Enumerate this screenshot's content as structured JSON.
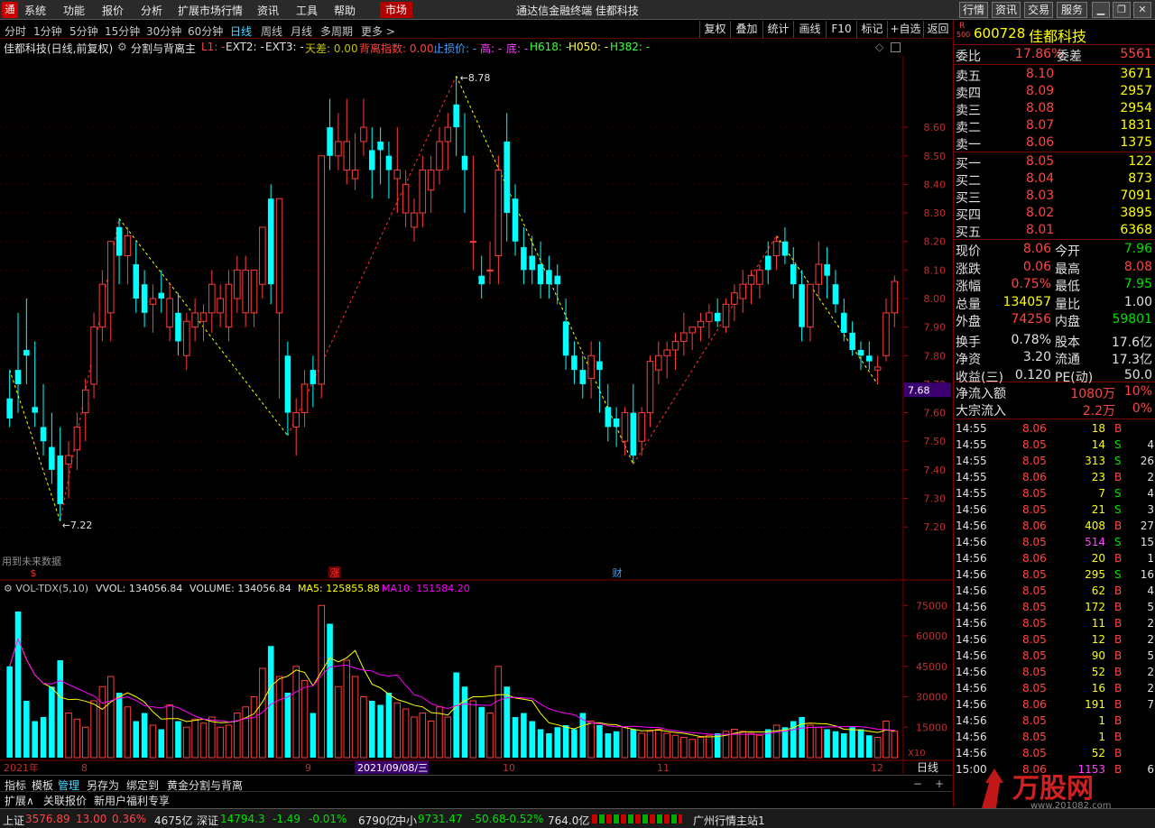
{
  "menu": {
    "items": [
      "系统",
      "功能",
      "报价",
      "分析",
      "扩展市场行情",
      "资讯",
      "工具",
      "帮助"
    ],
    "market": "市场",
    "title": "通达信金融终端  佳都科技",
    "right_buttons": [
      "行情",
      "资讯",
      "交易",
      "服务"
    ]
  },
  "timeframes": [
    "分时",
    "1分钟",
    "5分钟",
    "15分钟",
    "30分钟",
    "60分钟",
    "日线",
    "周线",
    "月线",
    "多周期",
    "更多 >"
  ],
  "active_timeframe": "日线",
  "tools": [
    "复权",
    "叠加",
    "统计",
    "画线",
    "F10",
    "标记",
    "+自选",
    "返回"
  ],
  "info": {
    "stock": "佳都科技(日线,前复权)",
    "indicator": "分割与背离主",
    "l1": "L1: -",
    "ext2": "EXT2: -",
    "ext3": "EXT3: -",
    "tiancha": "天差: 0.00",
    "beili": "背离指数: 0.00",
    "zhisun": "止损价: -",
    "gao": "高: -",
    "di": "底: -",
    "h618": "H618: -",
    "h050": "H050: -",
    "h382": "H382: -"
  },
  "chart_data": {
    "type": "candlestick",
    "ylim": [
      7.15,
      8.85
    ],
    "price_ticks": [
      "8.60",
      "8.50",
      "8.40",
      "8.30",
      "8.20",
      "8.10",
      "8.00",
      "7.90",
      "7.80",
      "7.70",
      "7.60",
      "7.50",
      "7.40",
      "7.30",
      "7.20"
    ],
    "price_label_current": "7.68",
    "high_label": "8.78",
    "low_label": "7.22",
    "future_data_text": "用到未来数据",
    "event_markers": [
      "$",
      "涨",
      "财"
    ],
    "vol_title": "VOL-TDX(5,10)",
    "vvol": "VVOL: 134056.84",
    "volume": "VOLUME: 134056.84",
    "ma5": "MA5: 125855.88",
    "ma10": "MA10: 151584.20",
    "vol_ticks": [
      "75000",
      "60000",
      "45000",
      "30000",
      "15000"
    ],
    "vol_unit": "X10",
    "x_labels": [
      "2021年",
      "8",
      "9",
      "2021/09/08/三",
      "10",
      "11",
      "12"
    ],
    "panel_label": "日线",
    "candles": [
      [
        7.65,
        7.75,
        7.55,
        7.58
      ],
      [
        7.75,
        7.95,
        7.6,
        7.7
      ],
      [
        7.82,
        8.0,
        7.7,
        7.8
      ],
      [
        7.62,
        7.85,
        7.55,
        7.6
      ],
      [
        7.55,
        7.7,
        7.45,
        7.5
      ],
      [
        7.48,
        7.6,
        7.35,
        7.4
      ],
      [
        7.45,
        7.55,
        7.22,
        7.28
      ],
      [
        7.42,
        7.5,
        7.3,
        7.45
      ],
      [
        7.47,
        7.6,
        7.4,
        7.55
      ],
      [
        7.6,
        7.72,
        7.5,
        7.68
      ],
      [
        7.7,
        7.95,
        7.65,
        7.9
      ],
      [
        7.9,
        8.1,
        7.85,
        8.05
      ],
      [
        7.95,
        8.15,
        7.85,
        8.2
      ],
      [
        8.25,
        8.28,
        8.05,
        8.15
      ],
      [
        8.15,
        8.25,
        8.05,
        8.22
      ],
      [
        8.12,
        8.2,
        7.95,
        8.0
      ],
      [
        8.05,
        8.1,
        7.9,
        7.95
      ],
      [
        7.98,
        8.05,
        7.88,
        8.0
      ],
      [
        8.02,
        8.1,
        7.95,
        8.0
      ],
      [
        7.9,
        8.05,
        7.85,
        8.0
      ],
      [
        7.95,
        8.02,
        7.8,
        7.85
      ],
      [
        7.8,
        7.95,
        7.75,
        7.92
      ],
      [
        7.9,
        8.0,
        7.85,
        7.95
      ],
      [
        7.92,
        7.98,
        7.85,
        7.95
      ],
      [
        7.95,
        8.1,
        7.88,
        8.05
      ],
      [
        7.95,
        8.05,
        7.9,
        8.0
      ],
      [
        7.9,
        8.1,
        7.85,
        8.05
      ],
      [
        8.0,
        8.15,
        7.95,
        8.1
      ],
      [
        7.95,
        8.15,
        7.9,
        8.1
      ],
      [
        7.95,
        8.1,
        7.9,
        8.1
      ],
      [
        8.05,
        8.25,
        8.0,
        8.25
      ],
      [
        8.35,
        8.4,
        7.98,
        8.05
      ],
      [
        7.95,
        8.35,
        7.65,
        8.35
      ],
      [
        7.8,
        7.85,
        7.52,
        7.6
      ],
      [
        7.55,
        7.65,
        7.45,
        7.6
      ],
      [
        7.6,
        7.75,
        7.55,
        7.7
      ],
      [
        7.75,
        7.8,
        7.62,
        7.7
      ],
      [
        7.7,
        8.5,
        7.65,
        8.5
      ],
      [
        8.6,
        8.7,
        8.45,
        8.5
      ],
      [
        8.5,
        8.65,
        8.45,
        8.55
      ],
      [
        8.45,
        8.7,
        8.4,
        8.55
      ],
      [
        8.42,
        8.58,
        8.38,
        8.45
      ],
      [
        8.55,
        8.7,
        8.5,
        8.6
      ],
      [
        8.52,
        8.6,
        8.35,
        8.45
      ],
      [
        8.55,
        8.6,
        8.4,
        8.52
      ],
      [
        8.5,
        8.55,
        8.35,
        8.45
      ],
      [
        8.42,
        8.6,
        8.3,
        8.45
      ],
      [
        8.3,
        8.45,
        8.25,
        8.4
      ],
      [
        8.25,
        8.35,
        8.2,
        8.3
      ],
      [
        8.3,
        8.5,
        8.25,
        8.45
      ],
      [
        8.38,
        8.5,
        8.3,
        8.45
      ],
      [
        8.45,
        8.6,
        8.4,
        8.55
      ],
      [
        8.55,
        8.65,
        8.45,
        8.6
      ],
      [
        8.68,
        8.78,
        8.5,
        8.6
      ],
      [
        8.5,
        8.65,
        8.3,
        8.45
      ],
      [
        8.2,
        8.5,
        8.1,
        8.2
      ],
      [
        8.08,
        8.15,
        8.0,
        8.05
      ],
      [
        8.1,
        8.2,
        8.05,
        8.1
      ],
      [
        8.15,
        8.5,
        8.05,
        8.45
      ],
      [
        8.55,
        8.65,
        8.2,
        8.3
      ],
      [
        8.35,
        8.4,
        8.15,
        8.2
      ],
      [
        8.18,
        8.25,
        8.05,
        8.1
      ],
      [
        8.15,
        8.22,
        8.05,
        8.1
      ],
      [
        8.12,
        8.2,
        8.0,
        8.05
      ],
      [
        8.1,
        8.15,
        8.0,
        8.05
      ],
      [
        8.08,
        8.12,
        7.98,
        8.05
      ],
      [
        7.92,
        8.0,
        7.75,
        7.8
      ],
      [
        7.8,
        7.85,
        7.7,
        7.75
      ],
      [
        7.75,
        7.8,
        7.65,
        7.7
      ],
      [
        7.72,
        7.85,
        7.65,
        7.8
      ],
      [
        7.78,
        7.85,
        7.6,
        7.75
      ],
      [
        7.62,
        7.7,
        7.5,
        7.55
      ],
      [
        7.58,
        7.62,
        7.48,
        7.55
      ],
      [
        7.5,
        7.62,
        7.45,
        7.6
      ],
      [
        7.6,
        7.7,
        7.42,
        7.45
      ],
      [
        7.5,
        7.62,
        7.45,
        7.6
      ],
      [
        7.6,
        7.8,
        7.55,
        7.78
      ],
      [
        7.75,
        7.85,
        7.7,
        7.8
      ],
      [
        7.8,
        7.85,
        7.72,
        7.82
      ],
      [
        7.82,
        7.88,
        7.75,
        7.85
      ],
      [
        7.85,
        7.95,
        7.8,
        7.88
      ],
      [
        7.88,
        7.9,
        7.82,
        7.9
      ],
      [
        7.9,
        7.95,
        7.85,
        7.92
      ],
      [
        7.92,
        7.98,
        7.86,
        7.95
      ],
      [
        7.95,
        8.0,
        7.9,
        7.92
      ],
      [
        7.9,
        8.0,
        7.88,
        7.98
      ],
      [
        7.98,
        8.05,
        7.92,
        8.02
      ],
      [
        8.0,
        8.1,
        7.95,
        8.05
      ],
      [
        8.05,
        8.1,
        7.98,
        8.08
      ],
      [
        8.05,
        8.12,
        8.0,
        8.1
      ],
      [
        8.15,
        8.2,
        8.05,
        8.1
      ],
      [
        8.15,
        8.22,
        8.1,
        8.2
      ],
      [
        8.2,
        8.25,
        8.12,
        8.15
      ],
      [
        8.12,
        8.18,
        8.0,
        8.05
      ],
      [
        8.05,
        8.1,
        7.85,
        7.9
      ],
      [
        7.9,
        8.05,
        7.85,
        8.05
      ],
      [
        8.05,
        8.2,
        8.0,
        8.12
      ],
      [
        8.12,
        8.18,
        8.0,
        8.08
      ],
      [
        8.05,
        8.1,
        7.95,
        7.98
      ],
      [
        7.95,
        8.0,
        7.85,
        7.88
      ],
      [
        7.88,
        7.92,
        7.8,
        7.82
      ],
      [
        7.82,
        7.85,
        7.75,
        7.8
      ],
      [
        7.8,
        7.85,
        7.75,
        7.78
      ],
      [
        7.75,
        7.8,
        7.7,
        7.76
      ],
      [
        7.8,
        8.0,
        7.78,
        7.95
      ],
      [
        7.95,
        8.08,
        7.9,
        8.06
      ]
    ],
    "volumes": [
      45000,
      72000,
      28000,
      18000,
      20000,
      35000,
      48000,
      22000,
      19000,
      15000,
      28000,
      35000,
      40000,
      32000,
      25000,
      18000,
      22000,
      16000,
      14000,
      26000,
      18000,
      15000,
      19000,
      17000,
      20000,
      15000,
      16000,
      22000,
      25000,
      30000,
      44000,
      55000,
      40000,
      32000,
      45000,
      38000,
      22000,
      75000,
      66000,
      35000,
      48000,
      40000,
      30000,
      28000,
      26000,
      32000,
      27000,
      24000,
      20000,
      22000,
      18000,
      25000,
      20000,
      42000,
      35000,
      28000,
      25000,
      22000,
      45000,
      35000,
      20000,
      22000,
      18000,
      14000,
      12000,
      15000,
      16000,
      14000,
      22000,
      18000,
      16000,
      12000,
      13000,
      15000,
      14000,
      12000,
      13000,
      14000,
      12000,
      11000,
      10000,
      9000,
      10000,
      11000,
      12000,
      13000,
      14000,
      13000,
      12000,
      11000,
      14000,
      16000,
      15000,
      18000,
      20000,
      16000,
      15000,
      14000,
      13000,
      12000,
      15000,
      14000,
      11000,
      10000,
      18000,
      13000
    ]
  },
  "quote": {
    "code": "600728",
    "name": "佳都科技",
    "r_label": "R",
    "r_sub": "500",
    "webi_label": "委比",
    "webi": "17.86%",
    "weicha_label": "委差",
    "weicha": "5561",
    "asks": [
      {
        "label": "卖五",
        "price": "8.10",
        "vol": "3671"
      },
      {
        "label": "卖四",
        "price": "8.09",
        "vol": "2957"
      },
      {
        "label": "卖三",
        "price": "8.08",
        "vol": "2954"
      },
      {
        "label": "卖二",
        "price": "8.07",
        "vol": "1831"
      },
      {
        "label": "卖一",
        "price": "8.06",
        "vol": "1375"
      }
    ],
    "bids": [
      {
        "label": "买一",
        "price": "8.05",
        "vol": "122"
      },
      {
        "label": "买二",
        "price": "8.04",
        "vol": "873"
      },
      {
        "label": "买三",
        "price": "8.03",
        "vol": "7091"
      },
      {
        "label": "买四",
        "price": "8.02",
        "vol": "3895"
      },
      {
        "label": "买五",
        "price": "8.01",
        "vol": "6368"
      }
    ],
    "stats": [
      [
        {
          "l": "现价",
          "v": "8.06",
          "c": "#ff4444"
        },
        {
          "l": "今开",
          "v": "7.96",
          "c": "#00e000"
        }
      ],
      [
        {
          "l": "涨跌",
          "v": "0.06",
          "c": "#ff4444"
        },
        {
          "l": "最高",
          "v": "8.08",
          "c": "#ff4444"
        }
      ],
      [
        {
          "l": "涨幅",
          "v": "0.75%",
          "c": "#ff4444"
        },
        {
          "l": "最低",
          "v": "7.95",
          "c": "#00e000"
        }
      ],
      [
        {
          "l": "总量",
          "v": "134057",
          "c": "#ffff00"
        },
        {
          "l": "量比",
          "v": "1.00",
          "c": "#e0e0e0"
        }
      ],
      [
        {
          "l": "外盘",
          "v": "74256",
          "c": "#ff4444"
        },
        {
          "l": "内盘",
          "v": "59801",
          "c": "#00e000"
        }
      ],
      [
        {
          "l": "换手",
          "v": "0.78%",
          "c": "#e0e0e0"
        },
        {
          "l": "股本",
          "v": "17.6亿",
          "c": "#e0e0e0"
        }
      ],
      [
        {
          "l": "净资",
          "v": "3.20",
          "c": "#e0e0e0"
        },
        {
          "l": "流通",
          "v": "17.3亿",
          "c": "#e0e0e0"
        }
      ],
      [
        {
          "l": "收益(三)",
          "v": "0.120",
          "c": "#e0e0e0"
        },
        {
          "l": "PE(动)",
          "v": "50.0",
          "c": "#e0e0e0"
        }
      ]
    ],
    "flow": [
      {
        "l": "净流入额",
        "v": "1080万",
        "p": "10%"
      },
      {
        "l": "大宗流入",
        "v": "2.2万",
        "p": "0%"
      }
    ],
    "ticks": [
      [
        "14:55",
        "8.06",
        "18",
        "B",
        ""
      ],
      [
        "14:55",
        "8.05",
        "14",
        "S",
        "4"
      ],
      [
        "14:55",
        "8.05",
        "313",
        "S",
        "26"
      ],
      [
        "14:55",
        "8.06",
        "23",
        "B",
        "2"
      ],
      [
        "14:55",
        "8.05",
        "7",
        "S",
        "4"
      ],
      [
        "14:56",
        "8.05",
        "21",
        "S",
        "3"
      ],
      [
        "14:56",
        "8.06",
        "408",
        "B",
        "27"
      ],
      [
        "14:56",
        "8.05",
        "514",
        "S",
        "15"
      ],
      [
        "14:56",
        "8.06",
        "20",
        "B",
        "1"
      ],
      [
        "14:56",
        "8.05",
        "295",
        "S",
        "16"
      ],
      [
        "14:56",
        "8.05",
        "62",
        "B",
        "4"
      ],
      [
        "14:56",
        "8.05",
        "172",
        "B",
        "5"
      ],
      [
        "14:56",
        "8.05",
        "11",
        "B",
        "2"
      ],
      [
        "14:56",
        "8.05",
        "12",
        "B",
        "2"
      ],
      [
        "14:56",
        "8.05",
        "90",
        "B",
        "5"
      ],
      [
        "14:56",
        "8.05",
        "52",
        "B",
        "2"
      ],
      [
        "14:56",
        "8.05",
        "16",
        "B",
        "2"
      ],
      [
        "14:56",
        "8.06",
        "191",
        "B",
        "7"
      ],
      [
        "14:56",
        "8.05",
        "1",
        "B",
        ""
      ],
      [
        "14:56",
        "8.05",
        "1",
        "B",
        ""
      ],
      [
        "14:56",
        "8.05",
        "52",
        "B",
        ""
      ],
      [
        "15:00",
        "8.06",
        "1153",
        "B",
        "6"
      ]
    ]
  },
  "bottom": {
    "tabs": [
      "指标",
      "模板",
      "管理",
      "另存为",
      "绑定到",
      "黄金分割与背离"
    ],
    "tabs2": [
      "扩展∧",
      "关联报价",
      "新用户福利专享"
    ]
  },
  "status": {
    "sh": "上证",
    "sh_val": "3576.89",
    "sh_chg": "13.00",
    "sh_pct": "0.36%",
    "sh_amt": "4675亿",
    "sz": "深证",
    "sz_val": "14794.3",
    "sz_chg": "-1.49",
    "sz_pct": "-0.01%",
    "sz_amt": "6790亿",
    "zx": "中小",
    "zx_val": "9731.47",
    "zx_chg": "-50.68",
    "zx_pct": "-0.52%",
    "zx_amt": "764.0亿",
    "server": "广州行情主站1"
  },
  "watermark": {
    "text": "万股网",
    "url": "www.201082.com"
  },
  "colors": {
    "up": "#ff3c3c",
    "down": "#00ffff",
    "ma5": "#ffff00",
    "ma10": "#ff00ff",
    "zigzag_up": "#ff3030",
    "zigzag_down": "#ffff00"
  }
}
